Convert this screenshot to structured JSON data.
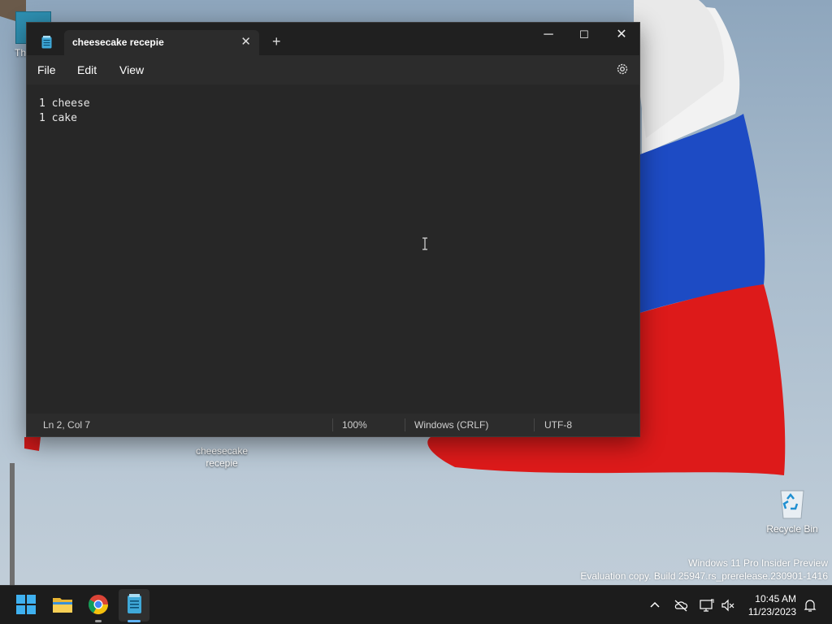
{
  "desktop": {
    "partial_icon_label": "Th",
    "file_icon_label_line1": "cheesecake",
    "file_icon_label_line2": "recepie",
    "recycle_bin_label": "Recycle Bin",
    "watermark_line1": "Windows 11 Pro Insider Preview",
    "watermark_line2": "Evaluation copy. Build 25947.rs_prerelease.230901-1416",
    "flag_colors": [
      "#ffffff",
      "#1e4fc9",
      "#e11d1d"
    ]
  },
  "window": {
    "app_icon": "notepad-icon",
    "tab_title": "cheesecake recepie",
    "tab_close": "✕",
    "new_tab": "+",
    "minimize": "─",
    "maximize": "☐",
    "close": "✕",
    "menu": {
      "file": "File",
      "edit": "Edit",
      "view": "View"
    },
    "settings_icon": "gear-icon",
    "content_lines": [
      "1 cheese",
      "1 cake"
    ],
    "status": {
      "position": "Ln 2, Col 7",
      "zoom": "100%",
      "line_ending": "Windows (CRLF)",
      "encoding": "UTF-8"
    }
  },
  "taskbar": {
    "icons": [
      "windows-start-icon",
      "file-explorer-icon",
      "chrome-icon",
      "notepad-icon"
    ],
    "tray_icons": [
      "chevron-up-icon",
      "cloud-offline-icon",
      "network-icon",
      "volume-mute-icon",
      "bell-icon"
    ],
    "time": "10:45 AM",
    "date": "11/23/2023"
  }
}
